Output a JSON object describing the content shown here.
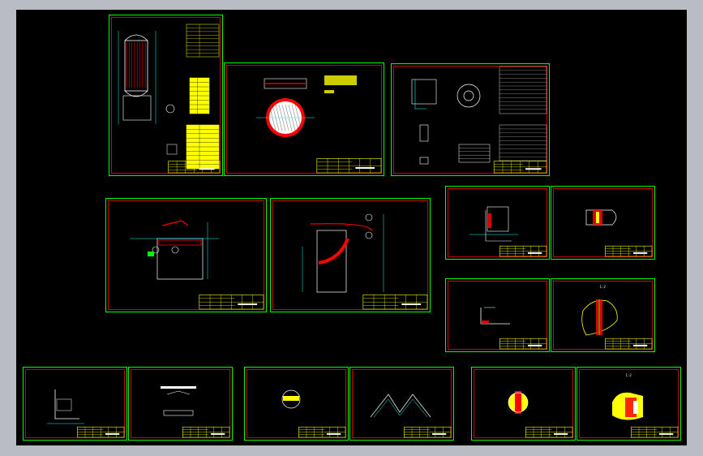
{
  "viewport": {
    "background": "#000000",
    "frame": "#b9bcc2"
  },
  "colors": {
    "sheet_border": "#00ff00",
    "inner_frame": "#ff0000",
    "table": "#ffff00",
    "line": "#ffffff",
    "dim": "#00ffff",
    "red": "#ff0000",
    "green": "#00ff00"
  },
  "sheets": [
    {
      "id": "s1",
      "content": "vessel-assembly"
    },
    {
      "id": "s2",
      "content": "tube-sheet"
    },
    {
      "id": "s3",
      "content": "flange-detail"
    },
    {
      "id": "s4",
      "content": "nozzle-section"
    },
    {
      "id": "s5",
      "content": "head-detail"
    },
    {
      "id": "s6",
      "content": "weld-detail-1"
    },
    {
      "id": "s7",
      "content": "weld-detail-2"
    },
    {
      "id": "s8",
      "content": "angle-weld"
    },
    {
      "id": "s9",
      "content": "detail-1-2",
      "label": "1:2"
    },
    {
      "id": "s10",
      "content": "small-detail-a"
    },
    {
      "id": "s11",
      "content": "small-detail-b"
    },
    {
      "id": "s12",
      "content": "circle-detail-a"
    },
    {
      "id": "s13",
      "content": "v-detail"
    },
    {
      "id": "s14",
      "content": "circle-detail-b"
    },
    {
      "id": "s15",
      "content": "flange-1-2",
      "label": "1:2"
    }
  ]
}
